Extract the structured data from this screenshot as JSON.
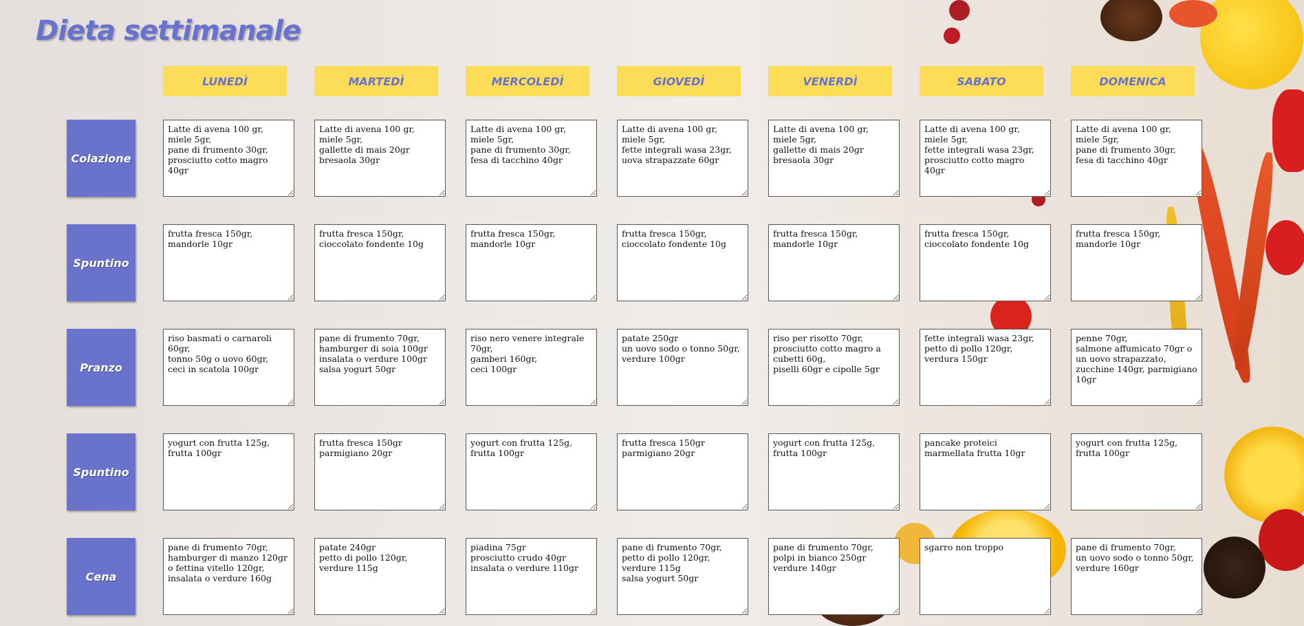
{
  "title": "Dieta settimanale",
  "colors": {
    "accent": "#6a73cc",
    "day_bg": "#fddc58"
  },
  "days": [
    "LUNEDÌ",
    "MARTEDÌ",
    "MERCOLEDÌ",
    "GIOVEDÌ",
    "VENERDÌ",
    "SABATO",
    "DOMENICA"
  ],
  "meals": [
    "Colazione",
    "Spuntino",
    "Pranzo",
    "Spuntino",
    "Cena"
  ],
  "grid": [
    [
      "Latte di avena 100 gr,\nmiele 5gr,\npane di frumento 30gr,\nprosciutto cotto magro 40gr",
      "Latte di avena 100 gr,\nmiele 5gr,\ngallette di mais 20gr\nbresaola 30gr",
      "Latte di avena 100 gr,\nmiele 5gr,\npane di frumento 30gr,\nfesa di tacchino 40gr",
      "Latte di avena 100 gr,\nmiele 5gr,\nfette integrali wasa 23gr,\nuova strapazzate 60gr",
      "Latte di avena 100 gr,\nmiele 5gr,\ngallette di mais 20gr\nbresaola 30gr",
      "Latte di avena 100 gr,\nmiele 5gr,\nfette integrali wasa 23gr,\nprosciutto cotto magro 40gr",
      "Latte di avena 100 gr,\nmiele 5gr,\npane di frumento 30gr,\nfesa di tacchino 40gr"
    ],
    [
      "frutta fresca 150gr,\nmandorle 10gr",
      "frutta fresca 150gr,\ncioccolato fondente 10g",
      "frutta fresca 150gr,\nmandorle 10gr",
      "frutta fresca 150gr,\ncioccolato fondente 10g",
      "frutta fresca 150gr,\nmandorle 10gr",
      "frutta fresca 150gr,\ncioccolato fondente 10g",
      "frutta fresca 150gr,\nmandorle 10gr"
    ],
    [
      "riso basmati o carnaroli 60gr,\ntonno 50g o uovo 60gr,\nceci in scatola 100gr",
      "pane di frumento 70gr,\nhamburger di soia 100gr\ninsalata o verdure 100gr\nsalsa yogurt 50gr",
      "riso nero venere integrale 70gr,\ngamberi 160gr,\nceci 100gr",
      "patate 250gr\nun uovo sodo o tonno 50gr,\nverdure 100gr",
      "riso per risotto 70gr,\nprosciutto cotto magro a cubetti 60g,\npiselli 60gr e cipolle 5gr",
      "fette integrali wasa 23gr,\npetto di pollo 120gr,\nverdura 150gr",
      "penne 70gr,\nsalmone affumicato 70gr o un uovo strapazzato,\nzucchine 140gr, parmigiano 10gr"
    ],
    [
      "yogurt con frutta 125g,\nfrutta 100gr",
      "frutta fresca 150gr\nparmigiano 20gr",
      "yogurt con frutta 125g,\nfrutta 100gr",
      "frutta fresca 150gr\nparmigiano 20gr",
      "yogurt con frutta 125g,\nfrutta 100gr",
      "pancake proteici\nmarmellata frutta 10gr",
      "yogurt con frutta 125g,\nfrutta 100gr"
    ],
    [
      "pane di frumento 70gr,\nhamburger di manzo 120gr o fettina vitello 120gr,\ninsalata o verdure 160g",
      "patate 240gr\npetto di pollo 120gr,\nverdure 115g",
      "piadina 75gr\nprosciutto crudo 40gr\ninsalata o verdure 110gr",
      "pane di frumento 70gr,\npetto di pollo 120gr,\nverdure 115g\nsalsa yogurt 50gr",
      "pane di frumento 70gr,\npolpi in bianco 250gr\nverdure 140gr",
      "sgarro non troppo",
      "pane di frumento 70gr,\nun uovo sodo o tonno 50gr,\nverdure 160gr"
    ]
  ]
}
